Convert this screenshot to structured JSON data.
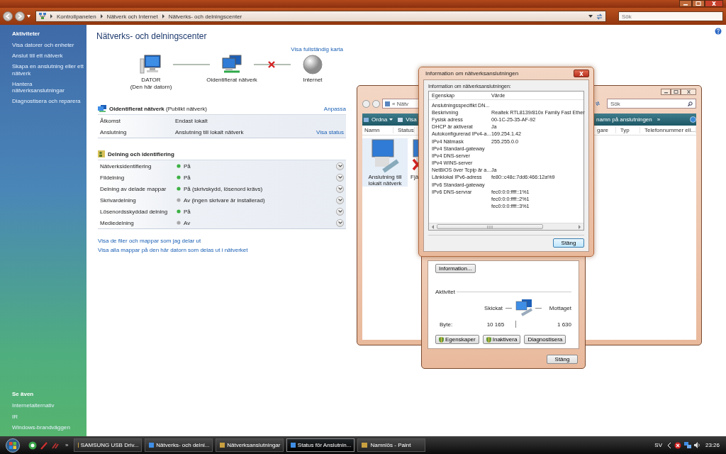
{
  "explorer": {
    "breadcrumbs": [
      "Kontrollpanelen",
      "Nätverk och Internet",
      "Nätverks- och delningscenter"
    ],
    "search_placeholder": "Sök",
    "sidebar": {
      "heading": "Aktiviteter",
      "items": [
        "Visa datorer och enheter",
        "Anslut till ett nätverk",
        "Skapa en anslutning eller ett nätverk",
        "Hantera nätverksanslutningar",
        "Diagnostisera och reparera"
      ],
      "see_also_heading": "Se även",
      "see_also": [
        "Internetalternativ",
        "IR",
        "Windows-brandväggen"
      ]
    },
    "title": "Nätverks- och delningscenter",
    "map_link": "Visa fullständig karta",
    "map_nodes": [
      {
        "kind": "computer",
        "label": "DATOR",
        "sublabel": "(Den här datorn)"
      },
      {
        "kind": "network",
        "label": "Oidentifierat nätverk"
      },
      {
        "kind": "internet",
        "label": "Internet"
      }
    ],
    "map_links": [
      {
        "connected": true
      },
      {
        "connected": false
      }
    ],
    "network": {
      "name": "**Oidentifierat nätverk** (Publikt nätverk)",
      "action": "Anpassa",
      "rows": [
        {
          "label": "Åtkomst",
          "value": "Endast lokalt"
        },
        {
          "label": "Anslutning",
          "value": "Anslutning till lokalt nätverk",
          "action": "Visa status"
        }
      ]
    },
    "sharing": {
      "heading": "Delning och identifiering",
      "rows": [
        {
          "label": "Nätverksidentifiering",
          "value": "På",
          "on": true
        },
        {
          "label": "Fildelning",
          "value": "På",
          "on": true
        },
        {
          "label": "Delning av delade mappar",
          "value": "På (skrivskydd, lösenord krävs)",
          "on": true
        },
        {
          "label": "Skrivardelning",
          "value": "Av (ingen skrivare är installerad)",
          "on": false
        },
        {
          "label": "Lösenordsskyddad delning",
          "value": "På",
          "on": true
        },
        {
          "label": "Mediedelning",
          "value": "Av",
          "on": false
        }
      ]
    },
    "links": [
      "Visa de filer och mappar som jag delar ut",
      "Visa alla mappar på den här datorn som delas ut i nätverket"
    ]
  },
  "connections_window": {
    "address": "« Nätv",
    "search_placeholder": "Sök",
    "toolbar_left": [
      "Ordna",
      "Visa"
    ],
    "toolbar_right": "namn på anslutningen",
    "overflow": "»",
    "columns_left": [
      "Namn",
      "Status"
    ],
    "columns_right": [
      "gare",
      "Typ",
      "Telefonnummer ell..."
    ],
    "items": [
      {
        "label": "Anslutning till lokalt nätverk",
        "selected": true,
        "connected": true
      },
      {
        "label": "Fjä",
        "selected": false,
        "connected": false
      }
    ]
  },
  "status_window": {
    "info_button": "Information...",
    "activity_heading": "Aktivitet",
    "sent_label": "Skickat",
    "received_label": "Mottaget",
    "bytes_label": "Byte:",
    "bytes_sent": "10 165",
    "bytes_received": "1 630",
    "buttons": [
      {
        "label": "Egenskaper",
        "shield": true
      },
      {
        "label": "Inaktivera",
        "shield": true
      },
      {
        "label": "Diagnostisera",
        "shield": false
      }
    ],
    "close": "Stäng"
  },
  "info_dialog": {
    "title": "Information om nätverksanslutningen",
    "caption": "Information om nätverksanslutningen:",
    "columns": [
      "Egenskap",
      "Värde"
    ],
    "rows": [
      {
        "property": "Anslutningsspecifikt DN..."
      },
      {
        "property": "Beskrivning",
        "value": "Realtek RTL8139/810x Family Fast Ether"
      },
      {
        "property": "Fysisk adress",
        "value": "00-1C-25-35-AF-92"
      },
      {
        "property": "DHCP är aktiverat",
        "value": "Ja"
      },
      {
        "property": "Autokonfigurerad IPv4-a...",
        "value": "169.254.1.42"
      },
      {
        "property": "IPv4 Nätmask",
        "value": "255.255.0.0"
      },
      {
        "property": "IPv4 Standard-gateway"
      },
      {
        "property": "IPv4 DNS-server"
      },
      {
        "property": "IPv4 WINS-server"
      },
      {
        "property": "NetBIOS över Tcpip är a...",
        "value": "Ja"
      },
      {
        "property": "Länklokal IPv6-adress",
        "value": "fe80::c48c:7dd6:466:12a%9"
      },
      {
        "property": "IPv6 Standard-gateway"
      },
      {
        "property": "IPv6 DNS-servrar",
        "value": "fec0:0:0:ffff::1%1"
      },
      {
        "value": "fec0:0:0:ffff::2%1"
      },
      {
        "value": "fec0:0:0:ffff::3%1"
      }
    ],
    "close": "Stäng"
  },
  "taskbar": {
    "items": [
      {
        "label": "SAMSUNG USB Driv...",
        "selected": false
      },
      {
        "label": "Nätverks- och delni...",
        "selected": false
      },
      {
        "label": "Nätverksanslutningar",
        "selected": false
      },
      {
        "label": "Status för Anslutnin...",
        "selected": true
      },
      {
        "label": "Namnlös - Paint",
        "selected": false
      }
    ],
    "overflow": "»",
    "language": "SV",
    "clock": "23:26"
  }
}
